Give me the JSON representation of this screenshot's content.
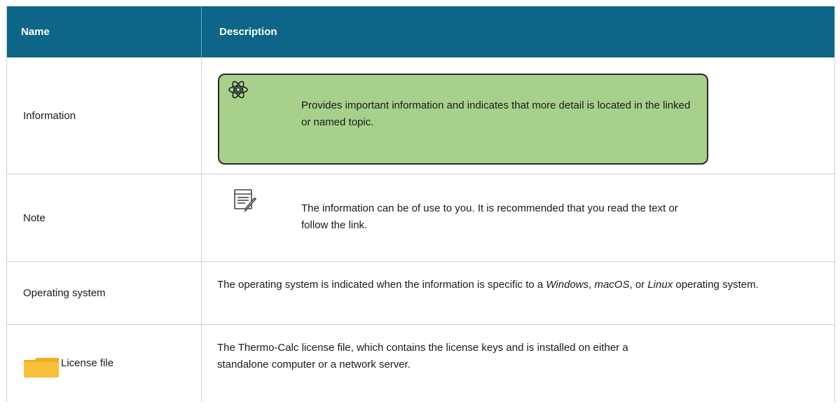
{
  "header": {
    "name_col": "Name",
    "desc_col": "Description"
  },
  "rows": [
    {
      "name": "Information",
      "icon": "atom-icon",
      "description": "Provides important information and indicates that more detail is located in the linked or named topic."
    },
    {
      "name": "Note",
      "icon": "note-icon",
      "description": "The information can be of use to you. It is recommended that you read the text or follow the link."
    },
    {
      "name": "Operating system",
      "description_parts": [
        "The operating system is indicated when the information is specific to a ",
        "Windows",
        ", ",
        "macOS",
        ", or ",
        "Linux",
        " operating system."
      ]
    },
    {
      "name": "License file",
      "icon": "folder-icon",
      "description": "The Thermo-Calc license file, which contains the license keys and is installed on either a standalone computer or a network server."
    }
  ],
  "colors": {
    "header_bg": "#0d6688",
    "callout_bg": "#a8d08d",
    "folder": "#f0b020"
  }
}
